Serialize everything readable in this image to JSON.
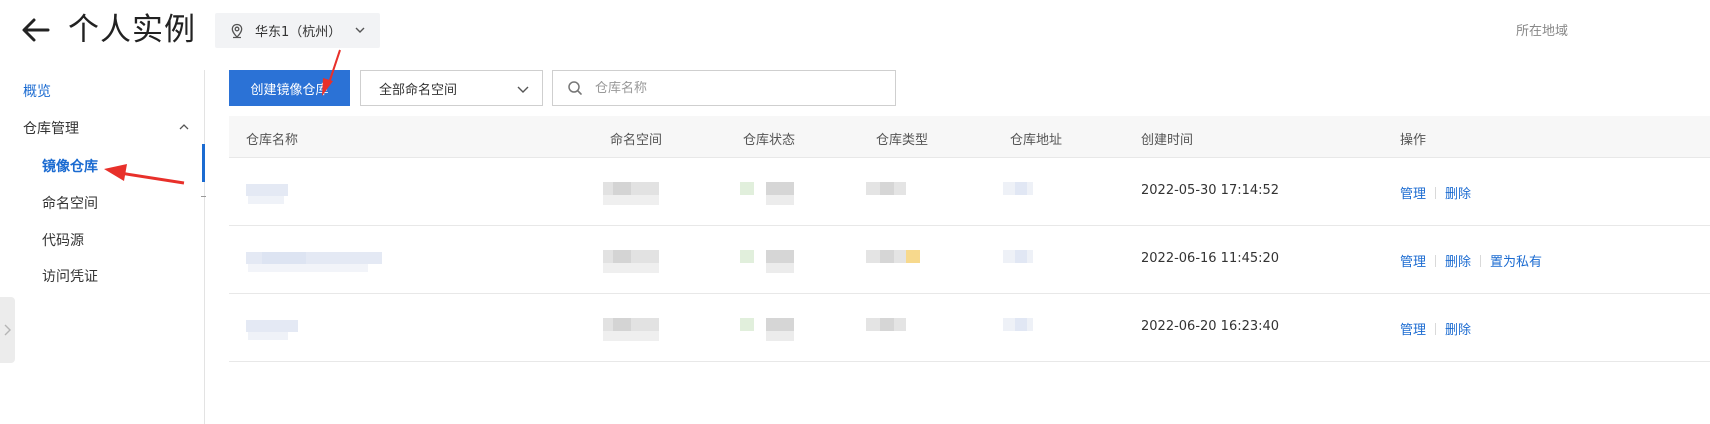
{
  "header": {
    "back_icon": "arrow-left-icon",
    "title": "个人实例",
    "region": {
      "icon": "location-pin-icon",
      "label": "华东1（杭州）"
    },
    "right_text": "所在地域"
  },
  "sidebar": {
    "overview": "概览",
    "group": {
      "label": "仓库管理",
      "expanded": true
    },
    "items": [
      {
        "label": "镜像仓库",
        "active": true
      },
      {
        "label": "命名空间",
        "active": false
      },
      {
        "label": "代码源",
        "active": false
      },
      {
        "label": "访问凭证",
        "active": false
      }
    ]
  },
  "toolbar": {
    "create_label": "创建镜像仓库",
    "namespace_select": "全部命名空间",
    "search_placeholder": "仓库名称"
  },
  "table": {
    "columns": [
      "仓库名称",
      "命名空间",
      "仓库状态",
      "仓库类型",
      "仓库地址",
      "创建时间",
      "操作"
    ],
    "rows": [
      {
        "created": "2022-05-30 17:14:52",
        "actions": [
          "管理",
          "删除"
        ]
      },
      {
        "created": "2022-06-16 11:45:20",
        "actions": [
          "管理",
          "删除",
          "置为私有"
        ]
      },
      {
        "created": "2022-06-20 16:23:40",
        "actions": [
          "管理",
          "删除"
        ]
      }
    ]
  },
  "colors": {
    "primary": "#2b72d6",
    "link": "#1b6bd1",
    "annotation": "#e8302a"
  }
}
